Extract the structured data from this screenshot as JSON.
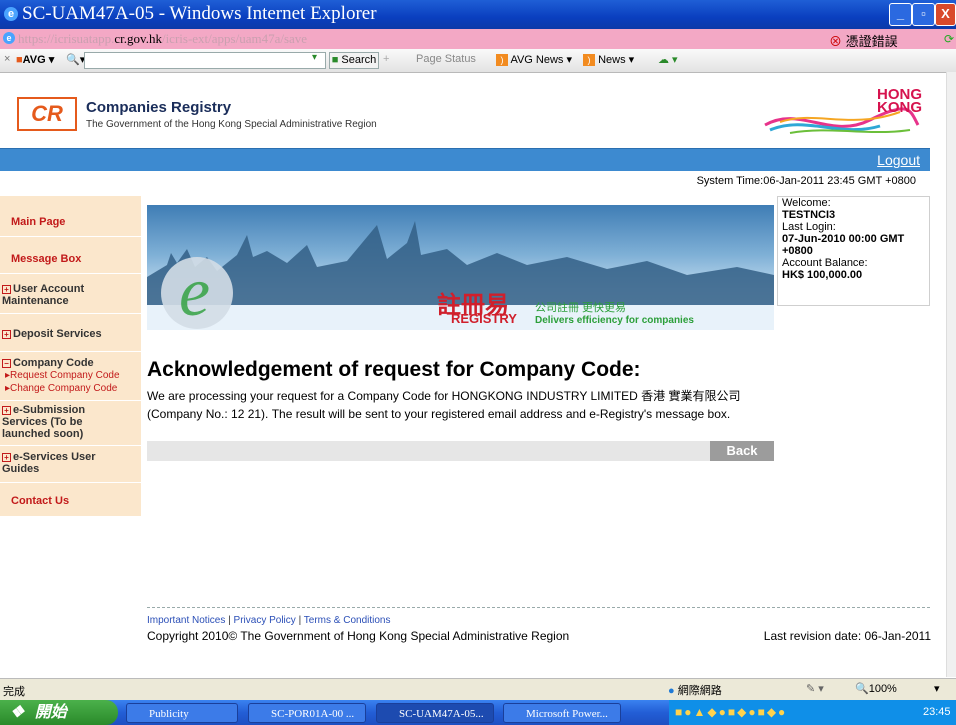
{
  "window": {
    "title": "SC-UAM47A-05 - Windows Internet Explorer",
    "url_dim_prefix": "https://icrisuatapp.",
    "url_domain": "cr.gov.hk",
    "url_dim_suffix": "/icris-ext/apps/uam47a/save",
    "cert_error": "憑證錯誤"
  },
  "toolbar": {
    "avg_label": "AVG",
    "search_label": "Search",
    "page_status": "Page Status",
    "avg_news": "AVG News",
    "news": "News"
  },
  "header": {
    "logo": "CR",
    "title": "Companies Registry",
    "subtitle": "The Government of the Hong Kong Special Administrative Region",
    "hk_logo_line1": "HONG",
    "hk_logo_line2": "KONG",
    "logout": "Logout",
    "system_time": "System Time:06-Jan-2011 23:45 GMT +0800"
  },
  "sidebar": {
    "main_page": "Main Page",
    "message_box": "Message Box",
    "user_account": "User Account Maintenance",
    "deposit": "Deposit Services",
    "company_code": "Company Code",
    "request_code": "Request Company Code",
    "change_code": "Change Company Code",
    "esubmission": "e-Submission Services (To be launched soon)",
    "eservices": "e-Services User Guides",
    "contact": "Contact Us"
  },
  "banner": {
    "chinese": "註冊易",
    "registry": "REGISTRY",
    "slogan_cn": "公司註冊 更快更易",
    "slogan_en": "Delivers efficiency for companies"
  },
  "welcome": {
    "welcome_label": "Welcome:",
    "user": "TESTNCI3",
    "last_login_label": "Last Login:",
    "last_login": "07-Jun-2010 00:00 GMT +0800",
    "balance_label": "Account Balance:",
    "balance": "HK$ 100,000.00"
  },
  "main": {
    "heading": "Acknowledgement of request for Company Code:",
    "body": "We are processing your request for a Company Code for HONGKONG                 INDUSTRY LIMITED 香港        實業有限公司 (Company No.: 12      21). The result will be sent to your registered email address and e-Registry's message box.",
    "back": "Back"
  },
  "footer": {
    "important": "Important Notices",
    "privacy": "Privacy Policy",
    "terms": "Terms & Conditions",
    "copyright": "Copyright 2010© The Government of Hong Kong Special Administrative Region",
    "revision": "Last revision date: 06-Jan-2011"
  },
  "statusbar": {
    "status": "完成",
    "zone": "網際網路",
    "zoom": "100%"
  },
  "taskbar": {
    "start": "開始",
    "tasks": [
      "Publicity",
      "SC-POR01A-00 ...",
      "SC-UAM47A-05...",
      "Microsoft Power..."
    ],
    "clock": "23:45"
  }
}
